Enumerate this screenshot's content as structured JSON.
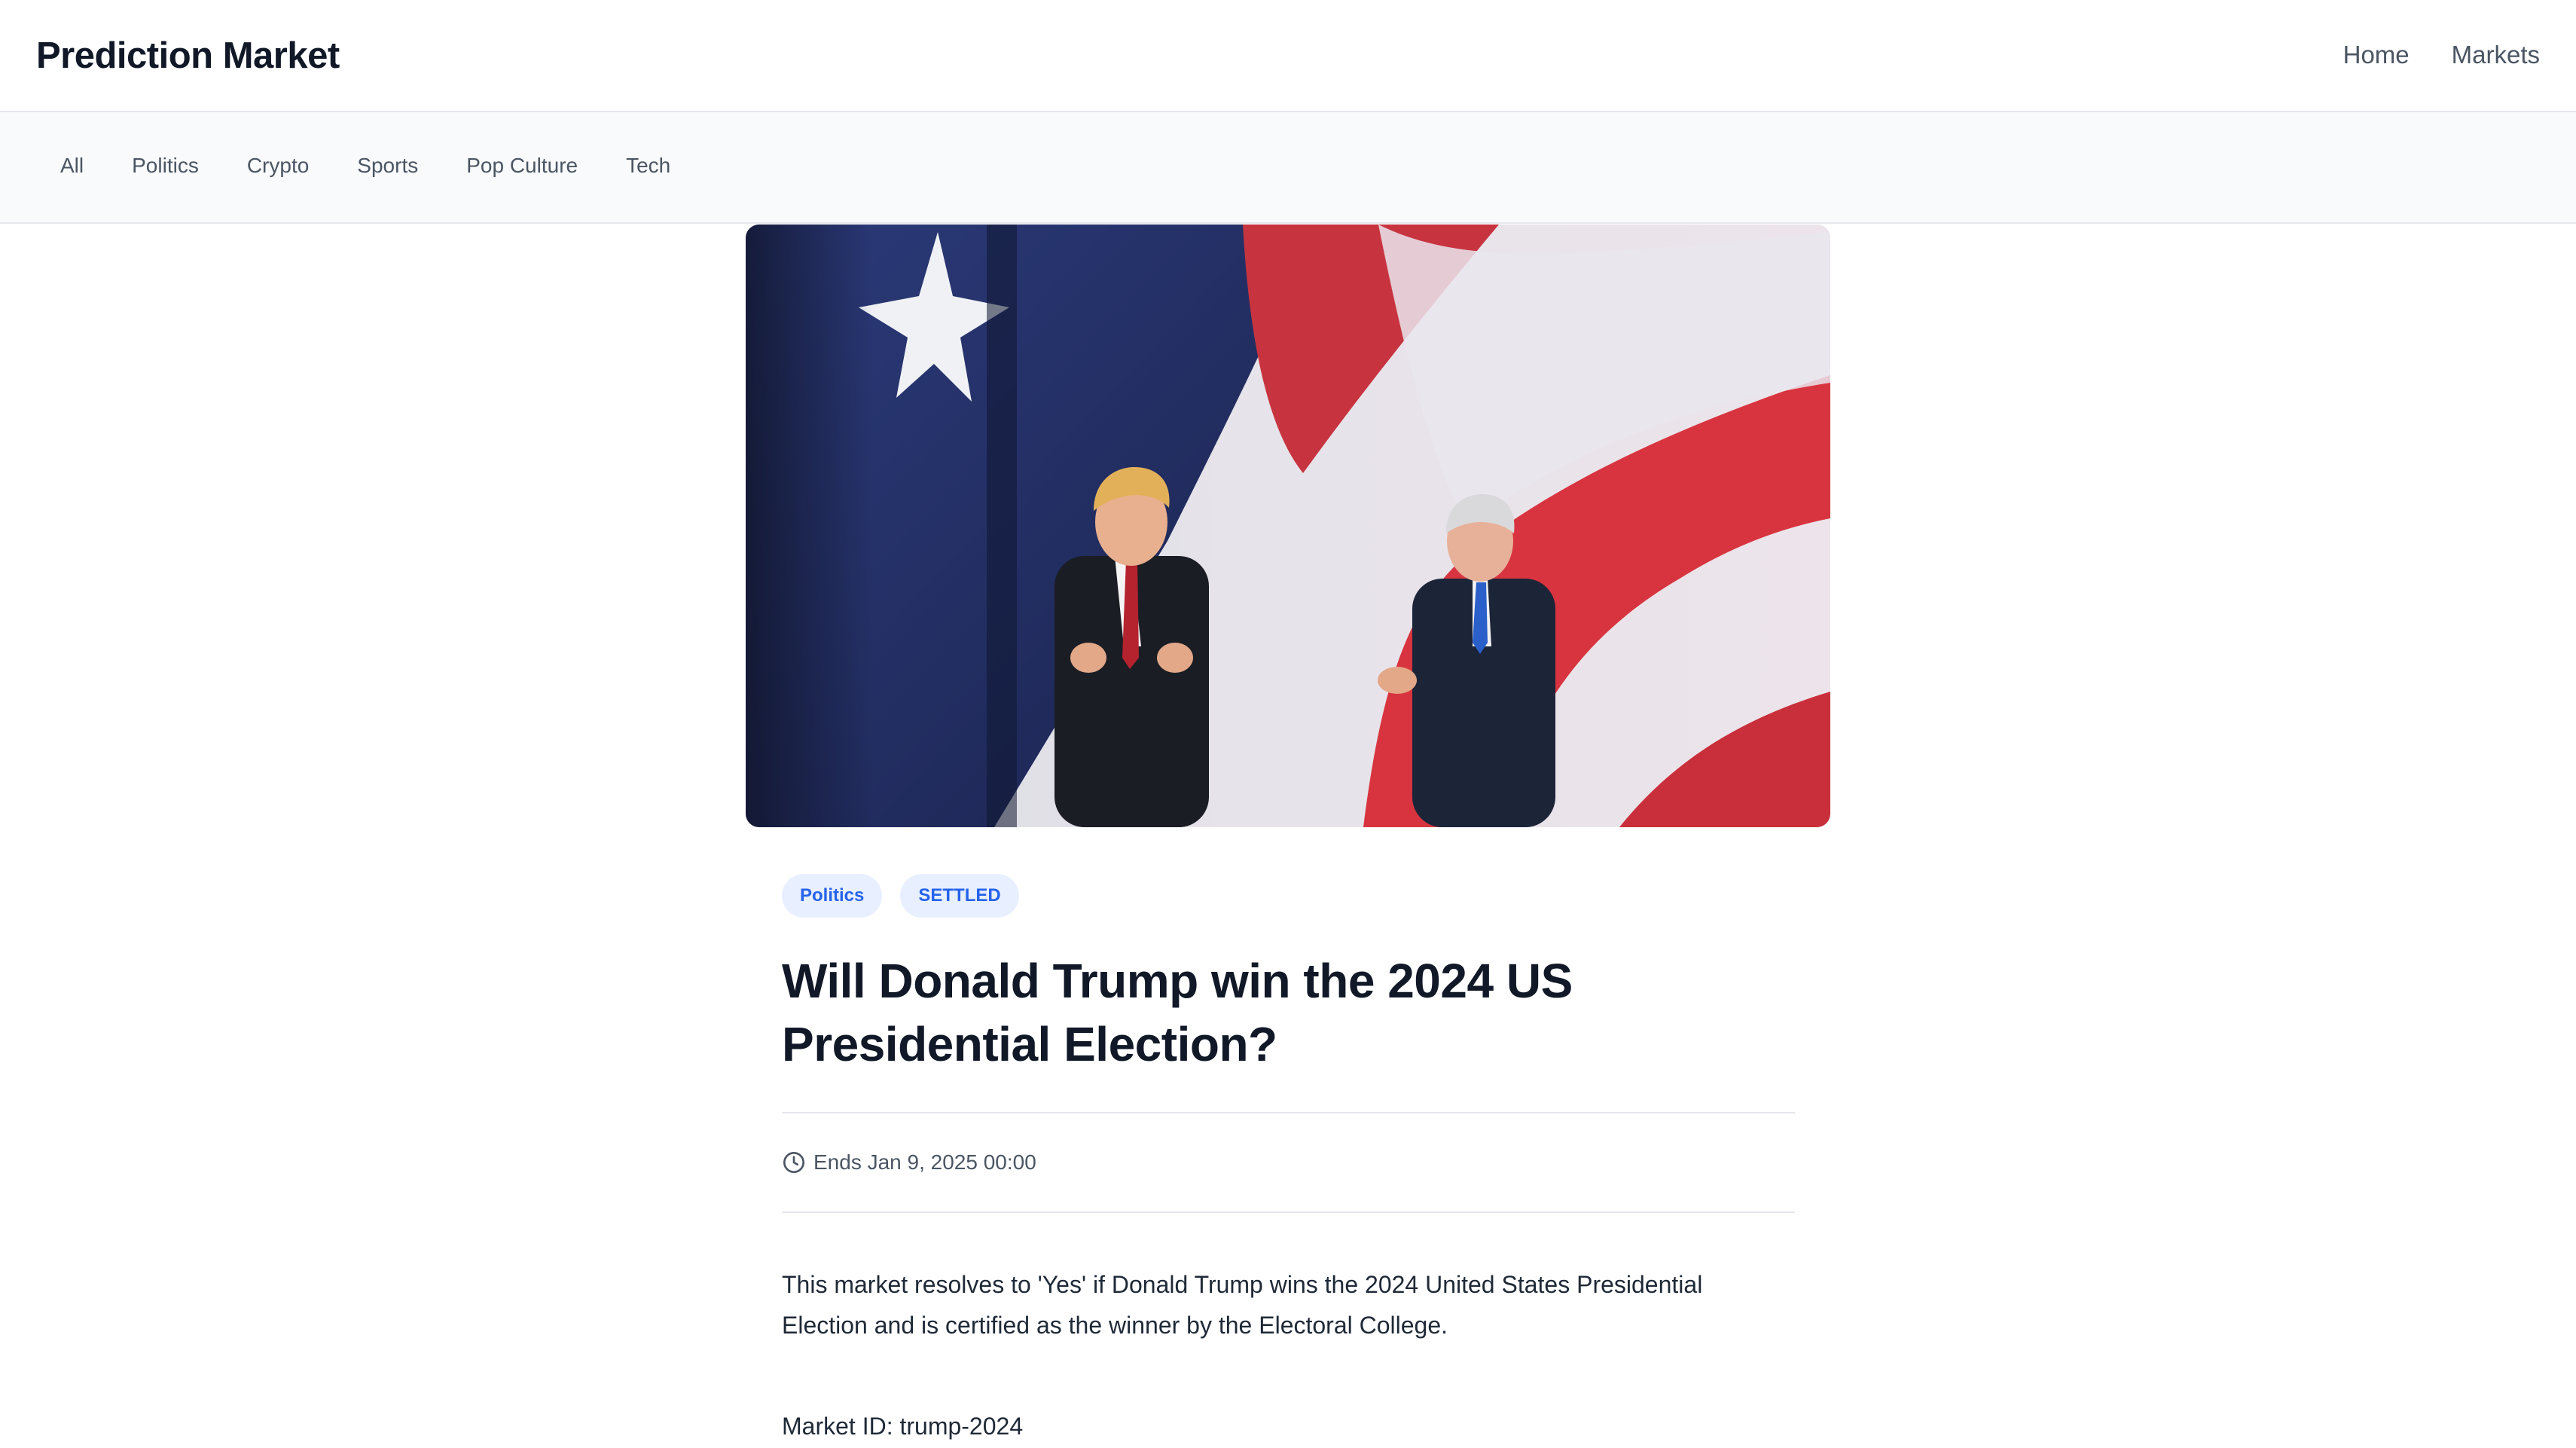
{
  "header": {
    "brand": "Prediction Market",
    "nav": [
      {
        "label": "Home"
      },
      {
        "label": "Markets"
      }
    ]
  },
  "categories": [
    {
      "label": "All"
    },
    {
      "label": "Politics"
    },
    {
      "label": "Crypto"
    },
    {
      "label": "Sports"
    },
    {
      "label": "Pop Culture"
    },
    {
      "label": "Tech"
    }
  ],
  "hero": {
    "image_icon": "photo-two-men-flag-backdrop"
  },
  "market": {
    "category_badge": "Politics",
    "status_badge": "SETTLED",
    "title": "Will Donald Trump win the 2024 US Presidential Election?",
    "ends": "Ends Jan 9, 2025 00:00",
    "description": "This market resolves to 'Yes' if Donald Trump wins the 2024 United States Presidential Election and is certified as the winner by the Electoral College.",
    "market_id": "Market ID: trump-2024"
  },
  "colors": {
    "accent": "#2563eb",
    "badge_bg": "#e8effe",
    "text_primary": "#111827",
    "text_muted": "#4b5563",
    "border": "#e5e7eb"
  }
}
